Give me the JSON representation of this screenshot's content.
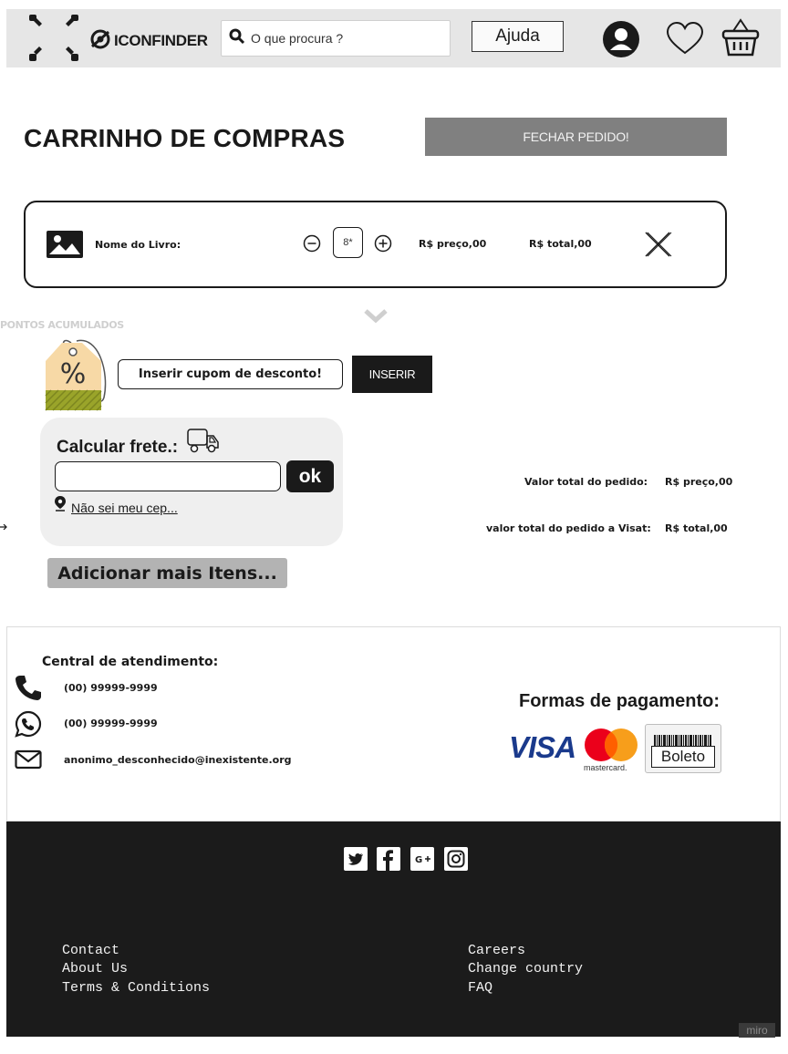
{
  "header": {
    "brand": "ICONFINDER",
    "search_placeholder": "O que procura ?",
    "help_label": "Ajuda",
    "icons": [
      "expand-frame-icon",
      "iconfinder-logo-icon",
      "search-icon",
      "user-icon",
      "heart-icon",
      "basket-icon"
    ]
  },
  "page": {
    "title": "CARRINHO DE COMPRAS",
    "close_order_label": "FECHAR PEDIDO!"
  },
  "cart_item": {
    "name": "Nome do Livro:",
    "quantity": "8*",
    "price": "R$ preço,00",
    "total": "R$ total,00"
  },
  "points_label": "PONTOS ACUMULADOS",
  "coupon": {
    "placeholder": "Inserir cupom de desconto!",
    "button_label": "INSERIR"
  },
  "freight": {
    "title": "Calcular frete.:",
    "ok_label": "ok",
    "cep_link": "Não sei meu cep..."
  },
  "add_more_label": "Adicionar mais Itens...",
  "totals": {
    "order_label": "Valor total do pedido:",
    "order_value": "R$ preço,00",
    "cash_label": "valor total do pedido a Visat:",
    "cash_value": "R$ total,00"
  },
  "contact": {
    "title": "Central de atendimento:",
    "phone": "(00) 99999-9999",
    "whatsapp": "(00) 99999-9999",
    "email": "anonimo_desconhecido@inexistente.org"
  },
  "payment": {
    "title": "Formas de pagamento:",
    "visa": "VISA",
    "mastercard": "mastercard.",
    "boleto": "Boleto"
  },
  "footer": {
    "social_icons": [
      "twitter-icon",
      "facebook-icon",
      "google-plus-icon",
      "instagram-icon"
    ],
    "left_links": [
      "Contact",
      "About Us",
      "Terms & Conditions"
    ],
    "right_links": [
      "Careers",
      "Change country",
      "FAQ"
    ],
    "watermark": "miro"
  },
  "colors": {
    "header_bg": "#e6e6e6",
    "footer_bg": "#1b1b1b",
    "button_dark": "#1a1a1a",
    "button_gray": "#808080",
    "visa_blue": "#1a3a8c",
    "mc_red": "#eb001b",
    "mc_orange": "#f79e1b"
  }
}
